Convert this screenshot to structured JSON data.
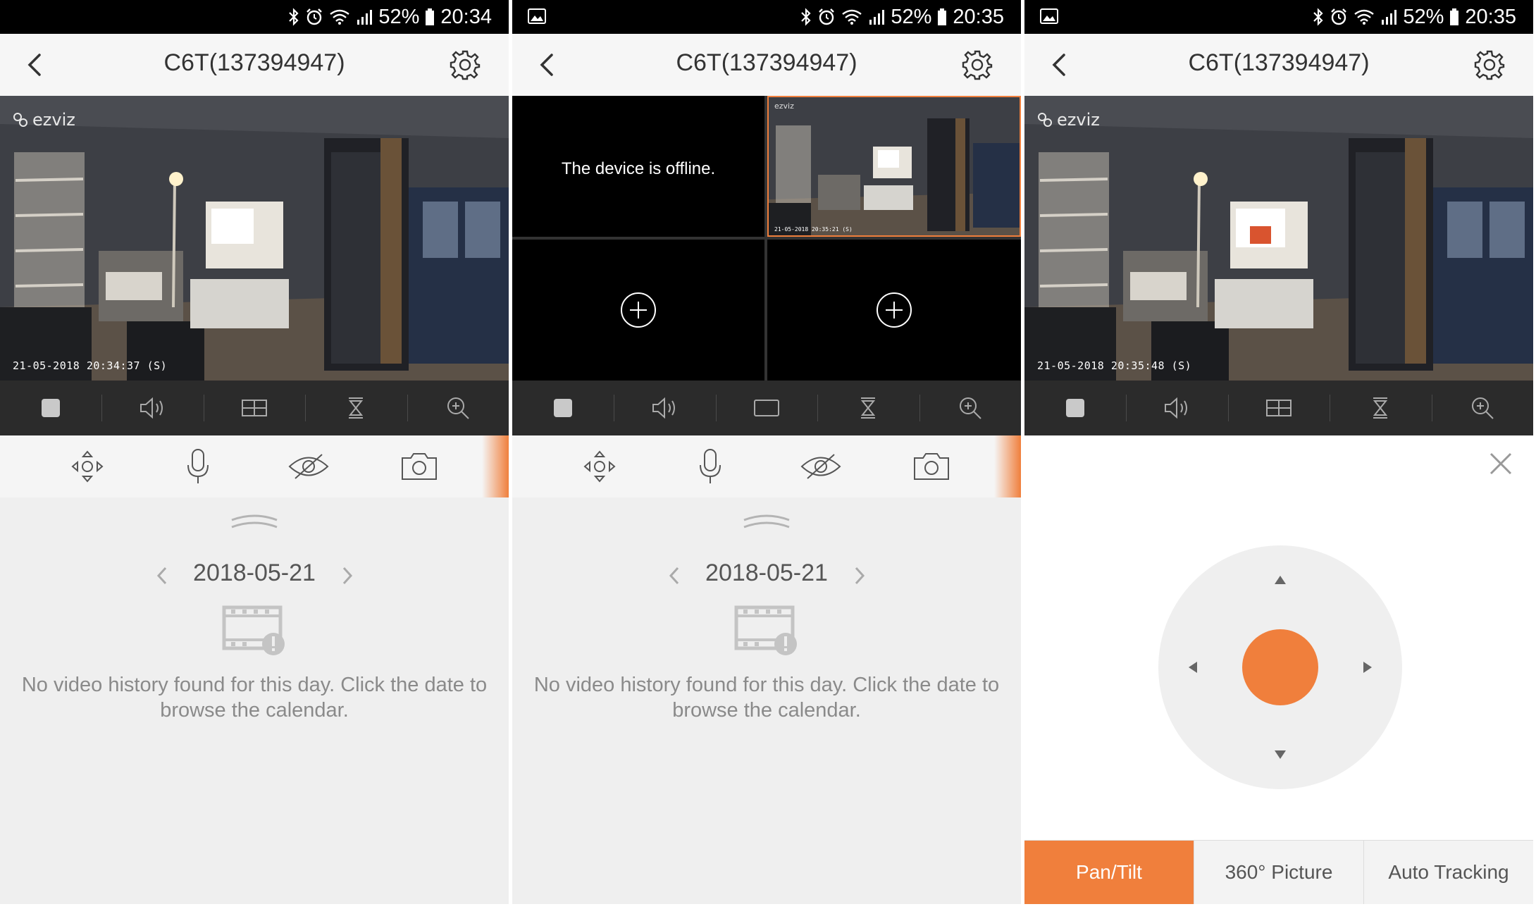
{
  "colors": {
    "accent": "#f07f3c",
    "statusbar": "#000000",
    "controlbar": "#2b2b2b"
  },
  "panels": [
    {
      "status": {
        "battery": "52%",
        "time": "20:34"
      },
      "title": "C6T(137394947)",
      "video": {
        "brand": "ezviz",
        "timestamp": "21-05-2018 20:34:37  (S)"
      },
      "date": "2018-05-21",
      "empty_message": "No video history found for this day. Click the date to browse the calendar."
    },
    {
      "status": {
        "battery": "52%",
        "time": "20:35"
      },
      "title": "C6T(137394947)",
      "offline_text": "The device is offline.",
      "thumb_timestamp": "21-05-2018 20:35:21  (S)",
      "date": "2018-05-21",
      "empty_message": "No video history found for this day. Click the date to browse the calendar."
    },
    {
      "status": {
        "battery": "52%",
        "time": "20:35"
      },
      "title": "C6T(137394947)",
      "video": {
        "brand": "ezviz",
        "timestamp": "21-05-2018 20:35:48  (S)"
      },
      "tabs": [
        "Pan/Tilt",
        "360° Picture",
        "Auto Tracking"
      ],
      "active_tab": "Pan/Tilt"
    }
  ],
  "icons": {
    "status_left": "image-icon",
    "status_right": [
      "bluetooth-icon",
      "alarm-icon",
      "wifi-icon",
      "signal-icon",
      "battery-icon"
    ],
    "controls": [
      "stop-icon",
      "volume-icon",
      "split-screen-icon",
      "quality-icon",
      "zoom-in-icon"
    ],
    "tools": [
      "ptz-icon",
      "microphone-icon",
      "privacy-icon",
      "camera-icon"
    ]
  }
}
